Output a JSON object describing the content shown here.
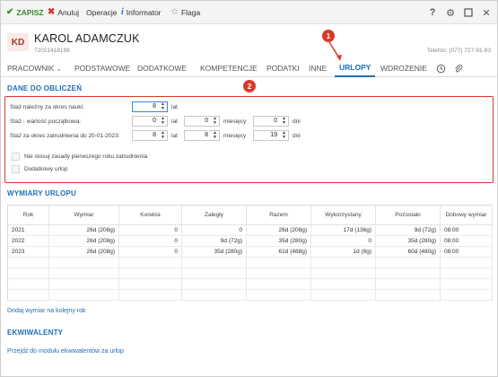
{
  "toolbar": {
    "save": "ZAPISZ",
    "cancel": "Anuluj",
    "operations": "Operacje",
    "informator": "Informator",
    "flag": "Flaga",
    "help_icon": "?"
  },
  "employee": {
    "initials": "KD",
    "name": "KAROL ADAMCZUK",
    "id": "72021418199",
    "phone": "Telefon: (077) 727-91-93"
  },
  "tabs": [
    {
      "label": "PRACOWNIK"
    },
    {
      "label": "PODSTAWOWE"
    },
    {
      "label": "DODATKOWE"
    },
    {
      "label": "KOMPETENCJE"
    },
    {
      "label": "PODATKI"
    },
    {
      "label": "INNE"
    },
    {
      "label": "URLOPY",
      "active": true
    },
    {
      "label": "WDROŻENIE"
    }
  ],
  "callouts": [
    "1",
    "2"
  ],
  "calc": {
    "title": "DANE DO OBLICZEŃ",
    "row1": {
      "label": "Staż należny za okres nauki:",
      "years": "8",
      "years_unit": "lat"
    },
    "row2": {
      "label": "Staż - wartość początkowa:",
      "years": "0",
      "years_unit": "lat",
      "months": "0",
      "months_unit": "miesięcy",
      "days": "0",
      "days_unit": "dni"
    },
    "row3": {
      "label": "Staż za okres zatrudnienia do 20-01-2023:",
      "years": "8",
      "years_unit": "lat",
      "months": "8",
      "months_unit": "miesięcy",
      "days": "19",
      "days_unit": "dni"
    },
    "check1": "Nie stosuj zasady pierwszego roku zatrudnienia",
    "check2": "Dodatkowy urlop"
  },
  "vacation": {
    "title": "WYMIARY URLOPU",
    "headers": [
      "Rok",
      "Wymiar",
      "Korekta",
      "Zaległy",
      "Razem",
      "Wykorzystany",
      "Pozostało",
      "Dobowy wymiar"
    ],
    "rows": [
      [
        "2021",
        "26d (208g)",
        "0",
        "0",
        "26d (208g)",
        "17d (136g)",
        "9d (72g)",
        "08:00"
      ],
      [
        "2022",
        "26d (208g)",
        "0",
        "9d (72g)",
        "35d (280g)",
        "0",
        "35d (280g)",
        "08:00"
      ],
      [
        "2023",
        "26d (208g)",
        "0",
        "35d (280g)",
        "61d (488g)",
        "1d (8g)",
        "60d (480g)",
        "08:00"
      ]
    ],
    "add_link": "Dodaj wymiar na kolejny rok"
  },
  "equivalents": {
    "title": "EKWIWALENTY",
    "link": "Przejdź do modułu ekwiwalentów za urlop"
  }
}
